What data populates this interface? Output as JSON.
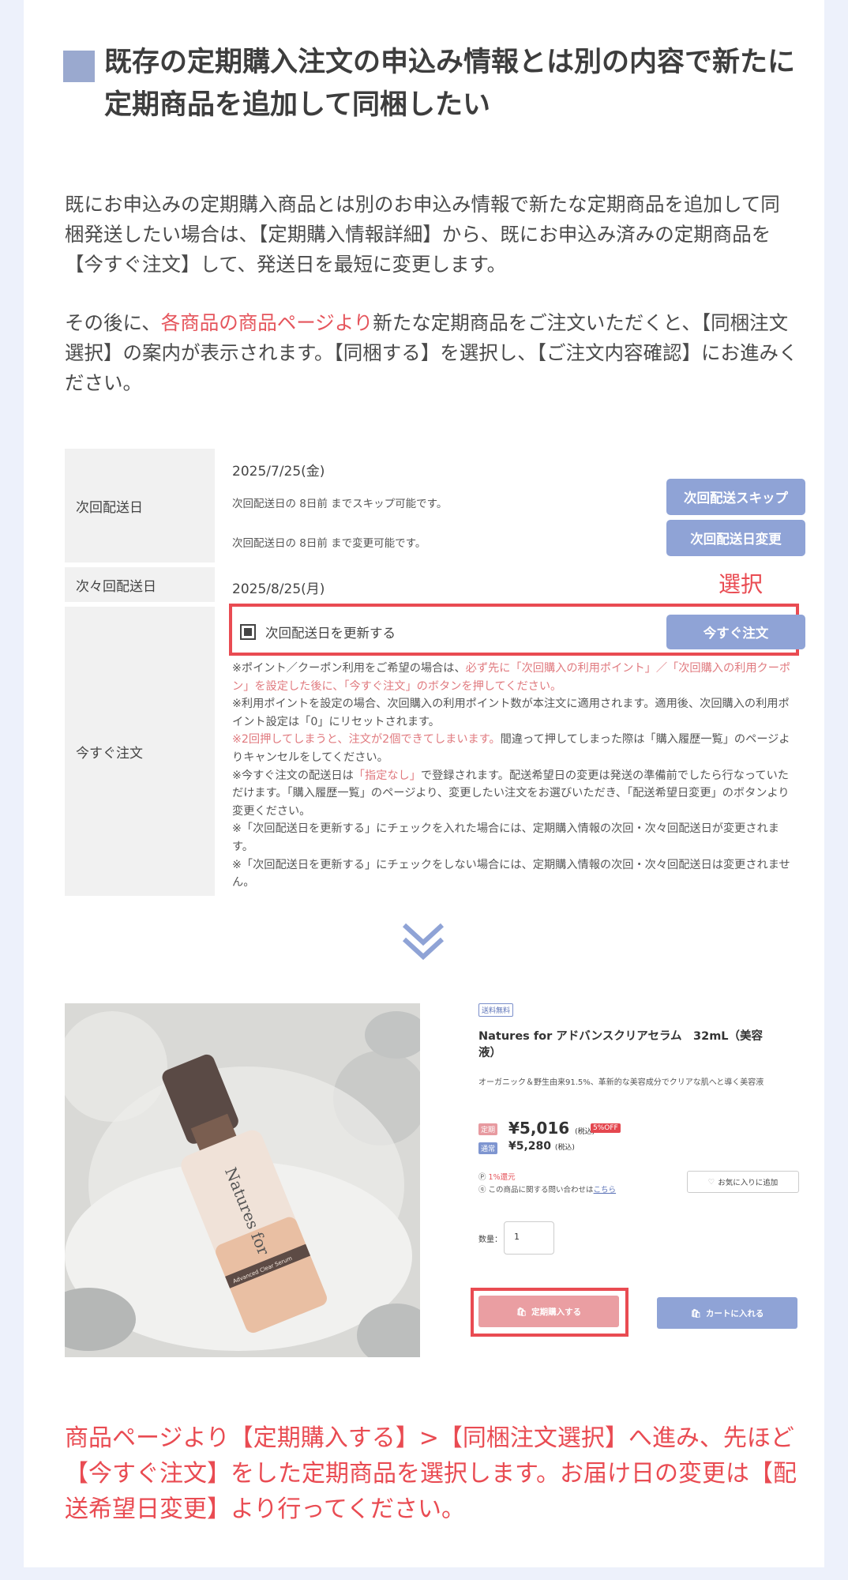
{
  "heading": "既存の定期購入注文の申込み情報とは別の内容で新たに定期商品を追加して同梱したい",
  "intro": "既にお申込みの定期購入商品とは別のお申込み情報で新たな定期商品を追加して同梱発送したい場合は、【定期購入情報詳細】から、既にお申込み済みの定期商品を【今すぐ注文】して、発送日を最短に変更します。",
  "para2": {
    "before": "その後に、",
    "link": "各商品の商品ページより",
    "after": "新たな定期商品をご注文いただくと、【同梱注文選択】の案内が表示されます。【同梱する】を選択し、【ご注文内容確認】にお進みください。"
  },
  "table": {
    "row1": {
      "label": "次回配送日",
      "date": "2025/7/25(金)",
      "skip_note": "次回配送日の 8日前 までスキップ可能です。",
      "change_note": "次回配送日の 8日前 まで変更可能です。",
      "skip_button": "次回配送スキップ",
      "change_button": "次回配送日変更"
    },
    "row2": {
      "label": "次々回配送日",
      "date": "2025/8/25(月)"
    },
    "select_annotation": "選択",
    "row3": {
      "label": "今すぐ注文",
      "checkbox_label": "次回配送日を更新する",
      "order_button": "今すぐ注文",
      "notes": [
        {
          "a": "※ポイント／クーポン利用をご希望の場合は、",
          "r": "必ず先に「次回購入の利用ポイント」／「次回購入の利用クーポン」を設定した後に、「今すぐ注文」のボタンを押してください。",
          "b": ""
        },
        {
          "a": "※利用ポイントを設定の場合、次回購入の利用ポイント数が本注文に適用されます。適用後、次回購入の利用ポイント設定は「0」にリセットされます。",
          "r": "",
          "b": ""
        },
        {
          "a": "",
          "r": "※2回押してしまうと、注文が2個できてしまいます。",
          "b": "間違って押してしまった際は「購入履歴一覧」のページよりキャンセルをしてください。"
        },
        {
          "a": "※今すぐ注文の配送日は",
          "r": "「指定なし」",
          "b": "で登録されます。配送希望日の変更は発送の準備前でしたら行なっていただけます。「購入履歴一覧」のページより、変更したい注文をお選びいただき、「配送希望日変更」のボタンより変更ください。"
        },
        {
          "a": "※「次回配送日を更新する」にチェックを入れた場合には、定期購入情報の次回・次々回配送日が変更されます。",
          "r": "",
          "b": ""
        },
        {
          "a": "※「次回配送日を更新する」にチェックをしない場合には、定期購入情報の次回・次々回配送日は変更されません。",
          "r": "",
          "b": ""
        }
      ]
    }
  },
  "product": {
    "bottle_text": "Natures for",
    "bottle_label": "Advanced Clear Serum",
    "free_shipping_tag": "送料無料",
    "name": "Natures for アドバンスクリアセラム　32mL（美容液）",
    "description": "オーガニック＆野生由来91.5%、革新的な美容成分でクリアな肌へと導く美容液",
    "subscription_badge": "定期",
    "subscription_price": "¥5,016",
    "tax_label": "(税込)",
    "discount_badge": "5%OFF",
    "regular_badge": "通常",
    "regular_price": "¥5,280",
    "points_text": "1%還元",
    "inquiry_text": "この商品に関する問い合わせは",
    "inquiry_link": "こちら",
    "favorite_button": "お気に入りに追加",
    "qty_label": "数量：",
    "qty_value": "1",
    "subscribe_button": "定期購入する",
    "cart_button": "カートに入れる"
  },
  "footer": "商品ページより【定期購入する】>【同梱注文選択】へ進み、先ほど【今すぐ注文】をした定期商品を選択します。お届け日の変更は【配送希望日変更】より行ってください。",
  "colors": {
    "accent_blue": "#8fa3d6",
    "accent_red": "#e94b52",
    "subscribe_pink": "#ea9ea2"
  }
}
